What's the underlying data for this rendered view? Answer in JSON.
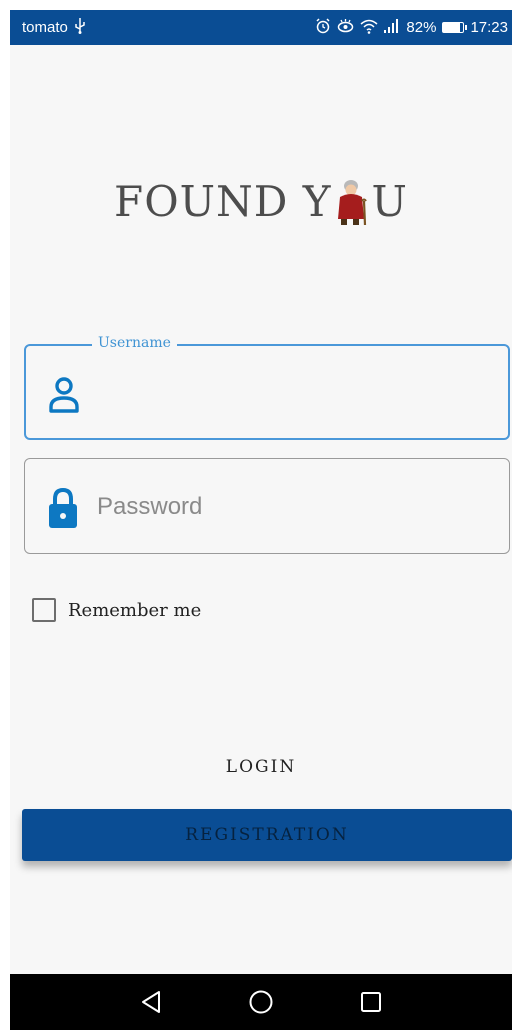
{
  "status_bar": {
    "carrier": "tomato",
    "battery_percent": "82%",
    "time": "17:23",
    "icons": [
      "usb-icon",
      "alarm-icon",
      "eye-comfort-icon",
      "wifi-icon",
      "signal-icon",
      "battery-icon"
    ]
  },
  "logo": {
    "text_before": "FOUND Y",
    "text_after": "U",
    "mascot": "grandma-icon"
  },
  "form": {
    "username": {
      "label": "Username",
      "value": "",
      "icon": "person-icon"
    },
    "password": {
      "placeholder": "Password",
      "value": "",
      "icon": "lock-icon"
    },
    "remember_me": {
      "label": "Remember me",
      "checked": false
    },
    "login_label": "LOGIN",
    "registration_label": "REGISTRATION"
  },
  "navigation": {
    "buttons": [
      "back-icon",
      "home-icon",
      "recents-icon"
    ]
  },
  "colors": {
    "primary": "#0a4d94",
    "focus": "#4b98d9",
    "background": "#f7f7f7"
  }
}
